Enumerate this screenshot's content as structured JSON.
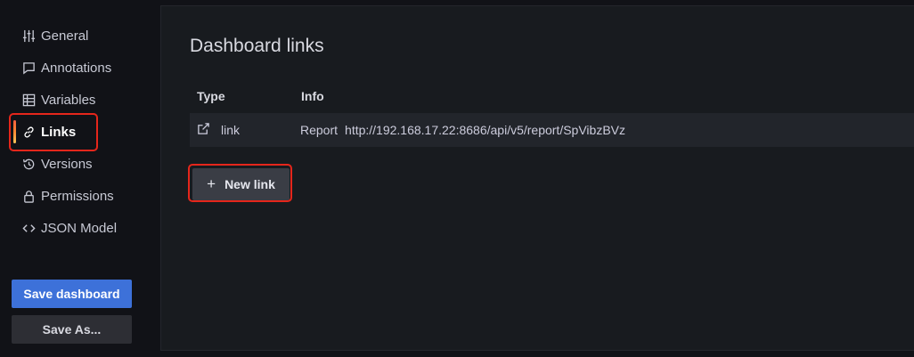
{
  "sidebar": {
    "items": [
      {
        "label": "General",
        "icon": "sliders-icon"
      },
      {
        "label": "Annotations",
        "icon": "comment-icon"
      },
      {
        "label": "Variables",
        "icon": "grid-icon"
      },
      {
        "label": "Links",
        "icon": "link-icon",
        "active": true
      },
      {
        "label": "Versions",
        "icon": "history-icon"
      },
      {
        "label": "Permissions",
        "icon": "lock-icon"
      },
      {
        "label": "JSON Model",
        "icon": "code-icon"
      }
    ],
    "save_label": "Save dashboard",
    "save_as_label": "Save As..."
  },
  "main": {
    "title": "Dashboard links",
    "table": {
      "columns": [
        "Type",
        "Info"
      ],
      "rows": [
        {
          "type": "link",
          "type_icon": "external-link-icon",
          "title": "Report",
          "url": "http://192.168.17.22:8686/api/v5/report/SpVibzBVz"
        }
      ]
    },
    "new_link_label": "New link",
    "new_link_icon": "+"
  },
  "colors": {
    "highlight": "#e5261b",
    "primary_button": "#3d71d9",
    "active_bar_gradient": [
      "#f55f3e",
      "#fbc55a"
    ]
  }
}
